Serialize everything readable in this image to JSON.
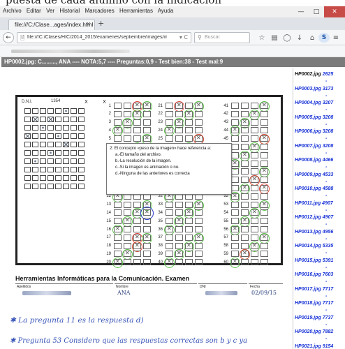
{
  "top_strip": "puesta de cada alumno con la indicación",
  "menu": [
    "Archivo",
    "Editar",
    "Ver",
    "Historial",
    "Marcadores",
    "Herramientas",
    "Ayuda"
  ],
  "tab": {
    "title": "file:///C:/Clase...ages/index.html"
  },
  "address": {
    "url": "file:///C:/Clases/HIC/2014_2015/examenes/septiembre/images/index.html",
    "search_placeholder": "Buscar"
  },
  "info_bar": "HP0002.jpg: C........., ANA ---- NOTA:5,7 ---- Preguntas:0,9 - Test bien:38 - Test mal:9",
  "sheet": {
    "id_label": "D.N.I.",
    "id_number": "1354",
    "tooltip": {
      "question": "2: El concepto «peso de la imagen» hace referencia a:",
      "options": [
        "a.-El tamaño del archivo.",
        "b.-La resolución de la imagen.",
        "c.-Si la imagen es animación o no.",
        "d.-Ninguna de las anteriores es correcta"
      ]
    },
    "footer": {
      "title": "Herramientas Informáticas para la Comunicación.  Examen",
      "labels": [
        "Apellidos",
        "Nombre",
        "DNI",
        "Fecha"
      ],
      "nombre": "ANA",
      "fecha": "02/09/15"
    }
  },
  "notes": [
    "✱  La pregunta 11 es la respuesta d)",
    "✱  Pregunta 53  Considero que las respuestas correctas son b y c ya"
  ],
  "files": [
    {
      "name": "HP0002.jpg",
      "code": "2625"
    },
    {
      "name": "HP0003.jpg",
      "code": "3173"
    },
    {
      "name": "HP0004.jpg",
      "code": "3207"
    },
    {
      "name": "HP0005.jpg",
      "code": "3208"
    },
    {
      "name": "HP0006.jpg",
      "code": "3208"
    },
    {
      "name": "HP0007.jpg",
      "code": "3208"
    },
    {
      "name": "HP0008.jpg",
      "code": "4466"
    },
    {
      "name": "HP0009.jpg",
      "code": "4533"
    },
    {
      "name": "HP0010.jpg",
      "code": "4588"
    },
    {
      "name": "HP0011.jpg",
      "code": "4907"
    },
    {
      "name": "HP0012.jpg",
      "code": "4907"
    },
    {
      "name": "HP0013.jpg",
      "code": "4956"
    },
    {
      "name": "HP0014.jpg",
      "code": "5335"
    },
    {
      "name": "HP0015.jpg",
      "code": "5391"
    },
    {
      "name": "HP0016.jpg",
      "code": "7603"
    },
    {
      "name": "HP0017.jpg",
      "code": "7717"
    },
    {
      "name": "HP0018.jpg",
      "code": "7717"
    },
    {
      "name": "HP0019.jpg",
      "code": "7737"
    },
    {
      "name": "HP0020.jpg",
      "code": "7882"
    },
    {
      "name": "HP0021.jpg",
      "code": "9154"
    }
  ],
  "colors": {
    "link": "#1631d6",
    "info_bar": "#7b7b7b",
    "correct": "#5dc24a",
    "wrong": "#e2453a",
    "selected": "#2c3fce",
    "close": "#c74b46"
  }
}
